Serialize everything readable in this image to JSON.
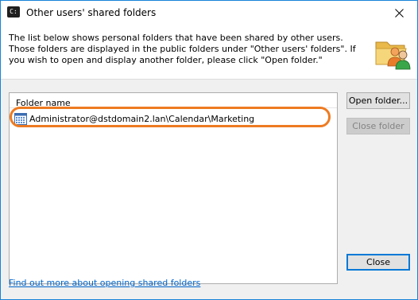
{
  "window": {
    "title": "Other users' shared folders",
    "title_icon_text": "C:",
    "close_icon": "close-icon"
  },
  "header": {
    "description": "The list below shows personal folders that have been shared by other users. Those folders are displayed in the public folders under \"Other users' folders\". If you wish to open and display another folder, please click \"Open folder.\"",
    "icon": "shared-folder-users-icon"
  },
  "list": {
    "column_header": "Folder name",
    "items": [
      {
        "icon": "calendar-icon",
        "label": "Administrator@dstdomain2.lan\\Calendar\\Marketing",
        "selected": false
      }
    ]
  },
  "buttons": {
    "open_folder": "Open folder...",
    "close_folder": "Close folder",
    "close_folder_enabled": false,
    "close": "Close"
  },
  "help_link": "Find out more about opening shared folders",
  "colors": {
    "accent": "#0078d7",
    "link": "#0066cc",
    "highlight_ring": "#ee7b22"
  }
}
